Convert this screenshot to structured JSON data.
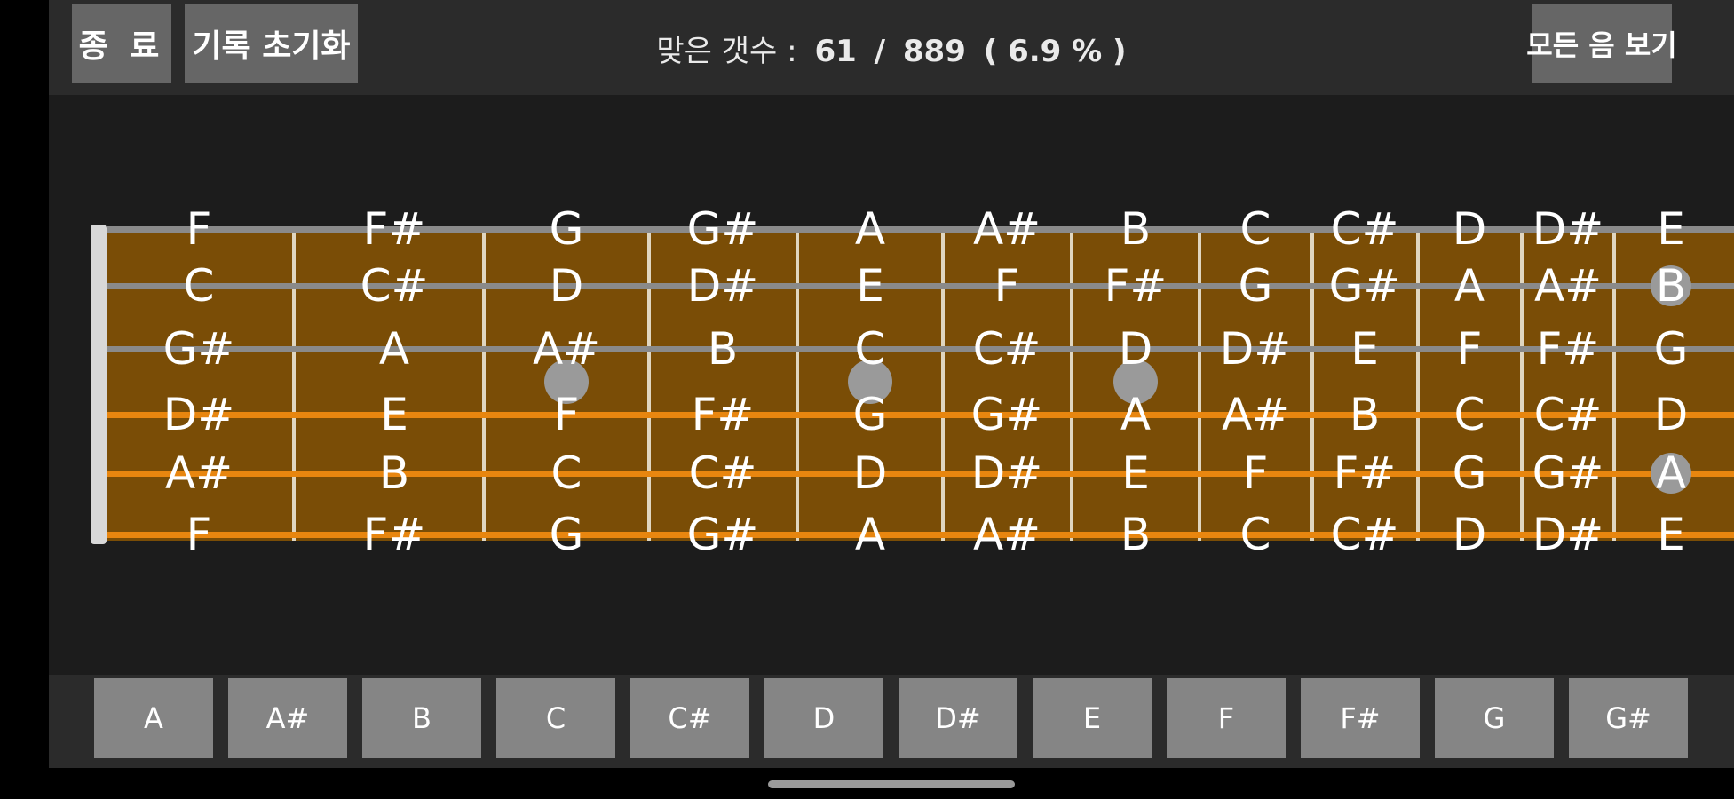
{
  "toolbar": {
    "exit_label": "종 료",
    "reset_label": "기록 초기화",
    "show_all_label": "모든 음 보기"
  },
  "score": {
    "label": "맞은 갯수 :",
    "correct": "61",
    "separator": "/",
    "total": "889",
    "percent": "( 6.9 % )"
  },
  "fretboard": {
    "strings": [
      {
        "notes": [
          "F",
          "F#",
          "G",
          "G#",
          "A",
          "A#",
          "B",
          "C",
          "C#",
          "D",
          "D#",
          "E"
        ],
        "color": "#8a8a8a"
      },
      {
        "notes": [
          "C",
          "C#",
          "D",
          "D#",
          "E",
          "F",
          "F#",
          "G",
          "G#",
          "A",
          "A#",
          "B"
        ],
        "color": "#8a8a8a"
      },
      {
        "notes": [
          "G#",
          "A",
          "A#",
          "B",
          "C",
          "C#",
          "D",
          "D#",
          "E",
          "F",
          "F#",
          "G"
        ],
        "color": "#8a8a8a"
      },
      {
        "notes": [
          "D#",
          "E",
          "F",
          "F#",
          "G",
          "G#",
          "A",
          "A#",
          "B",
          "C",
          "C#",
          "D"
        ],
        "color": "#e8860f"
      },
      {
        "notes": [
          "A#",
          "B",
          "C",
          "C#",
          "D",
          "D#",
          "E",
          "F",
          "F#",
          "G",
          "G#",
          "A"
        ],
        "color": "#e8860f"
      },
      {
        "notes": [
          "F",
          "F#",
          "G",
          "G#",
          "A",
          "A#",
          "B",
          "C",
          "C#",
          "D",
          "D#",
          "E"
        ],
        "color": "#e8860f"
      }
    ],
    "fret_markers": [
      3,
      5,
      7
    ],
    "double_marker": 12,
    "board_color": "#7a4d06",
    "nut_color": "#d8d8d8"
  },
  "note_buttons": [
    "A",
    "A#",
    "B",
    "C",
    "C#",
    "D",
    "D#",
    "E",
    "F",
    "F#",
    "G",
    "G#"
  ]
}
